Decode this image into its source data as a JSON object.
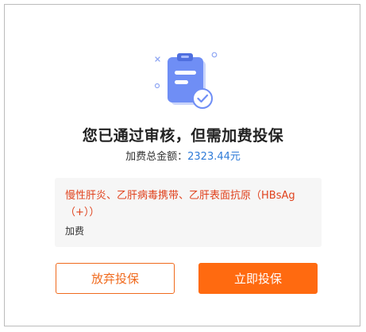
{
  "dialog": {
    "title": "您已通过审核，但需加费投保",
    "amount_label": "加费总金额：",
    "amount_value": "2323.44元",
    "notice": {
      "conditions": "慢性肝炎、乙肝病毒携带、乙肝表面抗原（HBsAg（+））",
      "action": "加费"
    },
    "buttons": {
      "abandon_label": "放弃投保",
      "confirm_label": "立即投保"
    }
  },
  "icons": {
    "illustration": "clipboard-check-icon"
  },
  "colors": {
    "accent": "#ff6a10",
    "accent_border": "#f06a1d",
    "amount": "#2f7bd8",
    "warning_text": "#e0421d",
    "illustration_blue": "#6f8ef5"
  }
}
